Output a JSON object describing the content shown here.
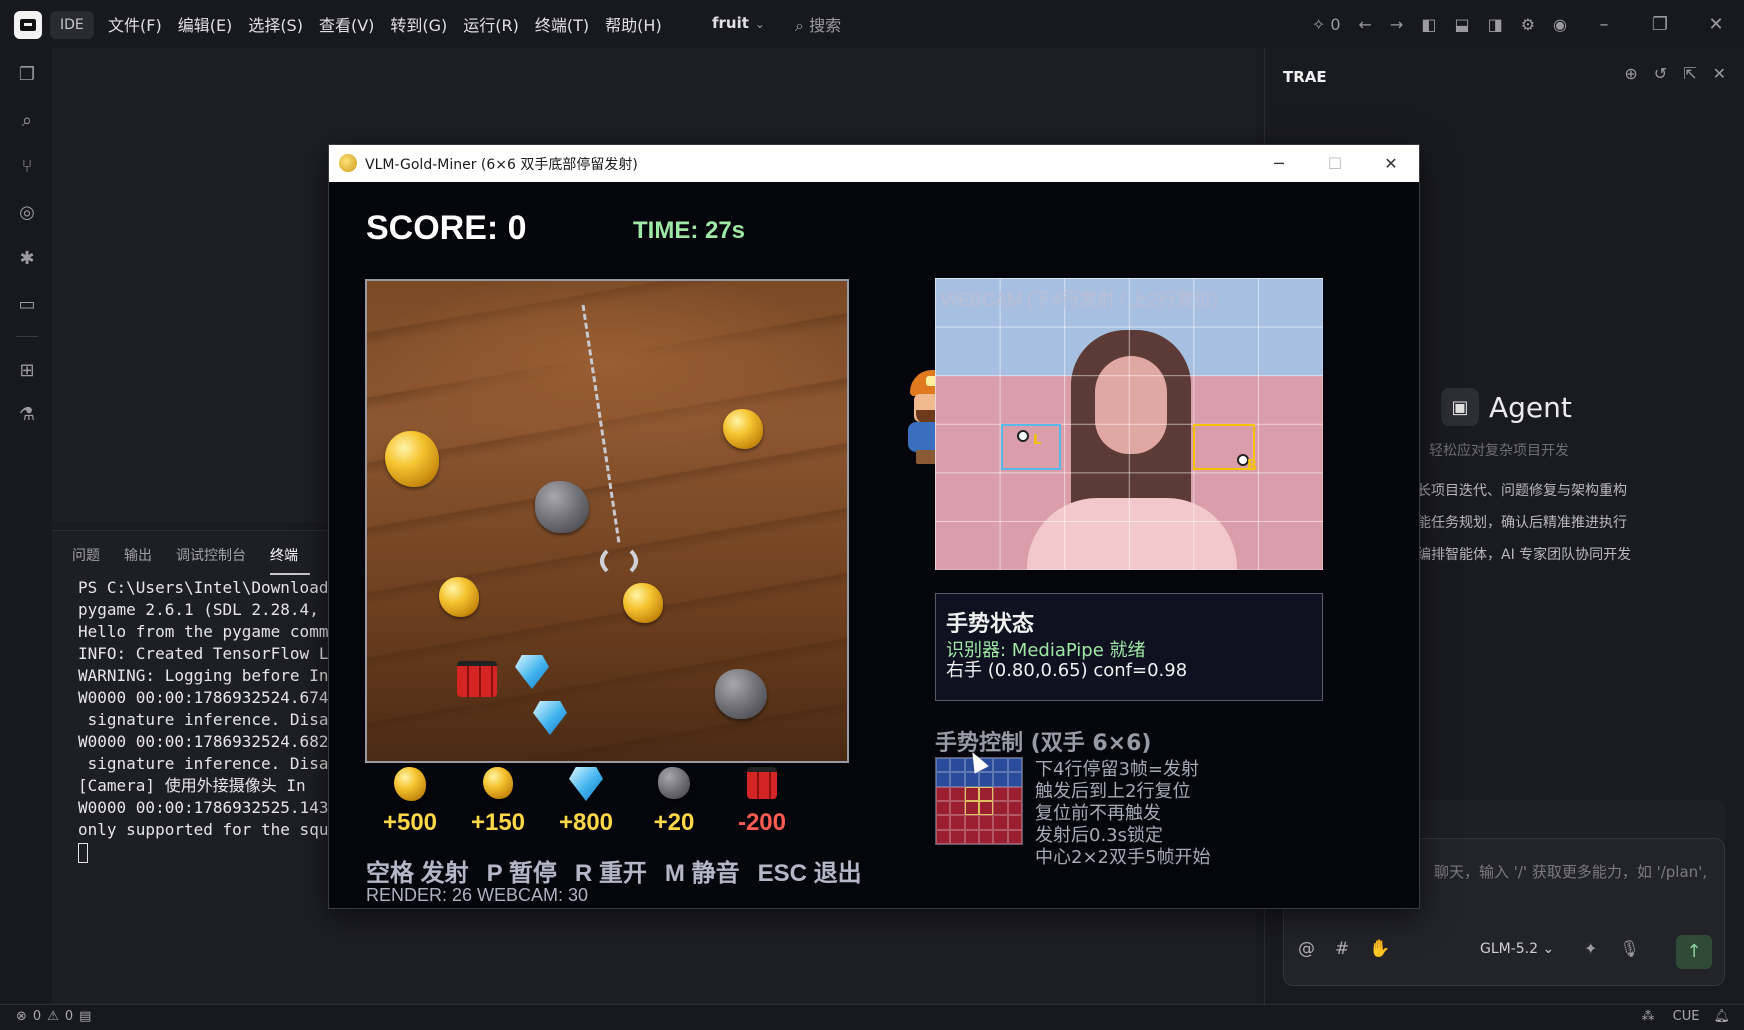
{
  "app": {
    "ide_tag": "IDE",
    "menu": [
      "文件(F)",
      "编辑(E)",
      "选择(S)",
      "查看(V)",
      "转到(G)",
      "运行(R)",
      "终端(T)",
      "帮助(H)"
    ],
    "branch": "fruit",
    "search_label": "搜索",
    "notif_count": "0"
  },
  "panel": {
    "tabs": [
      "问题",
      "输出",
      "调试控制台",
      "终端"
    ],
    "active_tab": "终端",
    "terminal_lines": [
      "PS C:\\Users\\Intel\\Download",
      "pygame 2.6.1 (SDL 2.28.4,",
      "Hello from the pygame comm",
      "INFO: Created TensorFlow L",
      "WARNING: Logging before In",
      "W0000 00:00:1786932524.674",
      " signature inference. Disa",
      "W0000 00:00:1786932524.682",
      " signature inference. Disa",
      "[Camera] 使用外接摄像头 In",
      "W0000 00:00:1786932525.143",
      "only supported for the squ"
    ]
  },
  "right": {
    "title": "TRAE",
    "agent_title": "Agent",
    "agent_subtitle": "轻松应对复杂项目开发",
    "agent_lines": [
      "长项目迭代、问题修复与架构重构",
      "能任务规划，确认后精准推进执行",
      "编排智能体，AI 专家团队协同开发"
    ],
    "chat_placeholder": "聊天，输入 '/' 获取更多能力，如 '/plan',",
    "model": "GLM-5.2"
  },
  "statusbar": {
    "errors": "0",
    "warnings": "0",
    "cue": "CUE"
  },
  "game": {
    "window_title": "VLM-Gold-Miner (6×6 双手底部停留发射)",
    "score_text": "SCORE: 0",
    "time_text": "TIME: 27s",
    "legend": [
      {
        "item": "big-gold",
        "value": "+500"
      },
      {
        "item": "gold",
        "value": "+150"
      },
      {
        "item": "diamond",
        "value": "+800"
      },
      {
        "item": "rock",
        "value": "+20"
      },
      {
        "item": "tnt",
        "value": "-200"
      }
    ],
    "controls": [
      "空格 发射",
      "P 暂停",
      "R 重开",
      "M 静音",
      "ESC 退出"
    ],
    "fps_text": "RENDER: 26   WEBCAM: 30",
    "webcam_label": "WEBCAM (下4行发射 / 上2行复位)",
    "hand_left_tag": "L",
    "hand_right_tag": "R",
    "gesture_status": {
      "title": "手势状态",
      "detector": "识别器: MediaPipe 就绪",
      "hand": "右手 (0.80,0.65) conf=0.98"
    },
    "gesture_control": {
      "title": "手势控制 (双手 6×6)",
      "lines": [
        "下4行停留3帧=发射",
        "触发后到上2行复位",
        "复位前不再触发",
        "发射后0.3s锁定",
        "中心2×2双手5帧开始"
      ]
    }
  }
}
